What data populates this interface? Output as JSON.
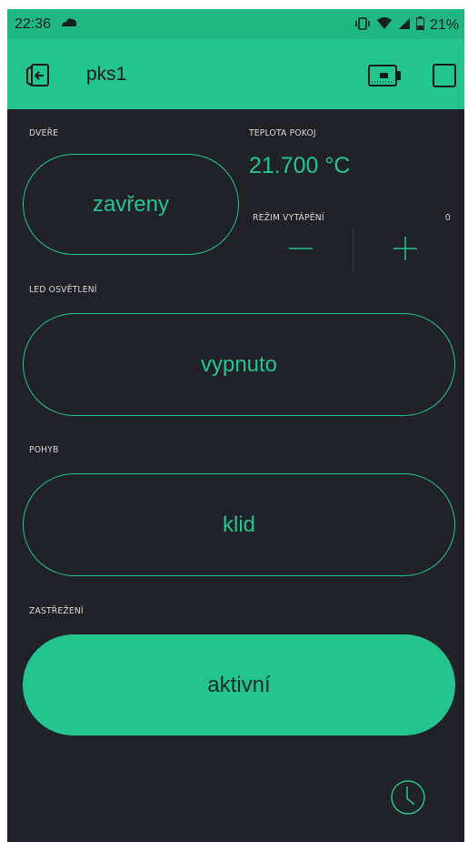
{
  "status_bar": {
    "time": "22:36",
    "battery": "21%",
    "icons": [
      "cloud-icon",
      "vibrate-icon",
      "wifi-icon",
      "signal-icon",
      "battery-icon"
    ]
  },
  "app_bar": {
    "title": "pks1",
    "icons": [
      "exit-icon",
      "device-icon",
      "square-icon"
    ]
  },
  "widgets": {
    "doors": {
      "label": "DVEŘE",
      "value": "zavřeny"
    },
    "temperature": {
      "label": "TEPLOTA POKOJ",
      "value": "21.700 °C"
    },
    "heating_mode": {
      "label": "REŽIM VYTÁPĚNÍ",
      "value": "0",
      "minus": "—",
      "plus": "+"
    },
    "led": {
      "label": "LED OSVĚTLENÍ",
      "value": "vypnuto"
    },
    "motion": {
      "label": "POHYB",
      "value": "klid"
    },
    "alarm": {
      "label": "ZASTŘEŽENÍ",
      "value": "aktivní"
    }
  },
  "colors": {
    "accent": "#23c48e",
    "background": "#212227",
    "label": "#d9d9d9"
  }
}
